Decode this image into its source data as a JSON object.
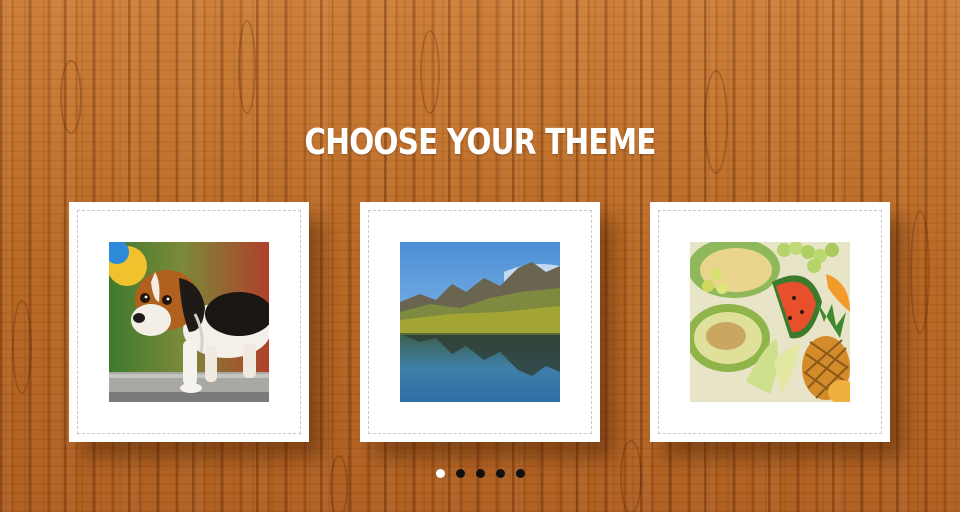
{
  "heading": {
    "title": "CHOOSE YOUR THEME"
  },
  "themes": [
    {
      "id": "puppy",
      "icon": "beagle-puppy-photo"
    },
    {
      "id": "landscape",
      "icon": "mountain-lake-photo"
    },
    {
      "id": "fruit",
      "icon": "fruit-platter-photo"
    }
  ],
  "pagination": {
    "count": 5,
    "active_index": 0
  },
  "colors": {
    "background": "#b8651f",
    "card": "#ffffff",
    "dot_active": "#ffffff",
    "dot_inactive": "#111111"
  }
}
